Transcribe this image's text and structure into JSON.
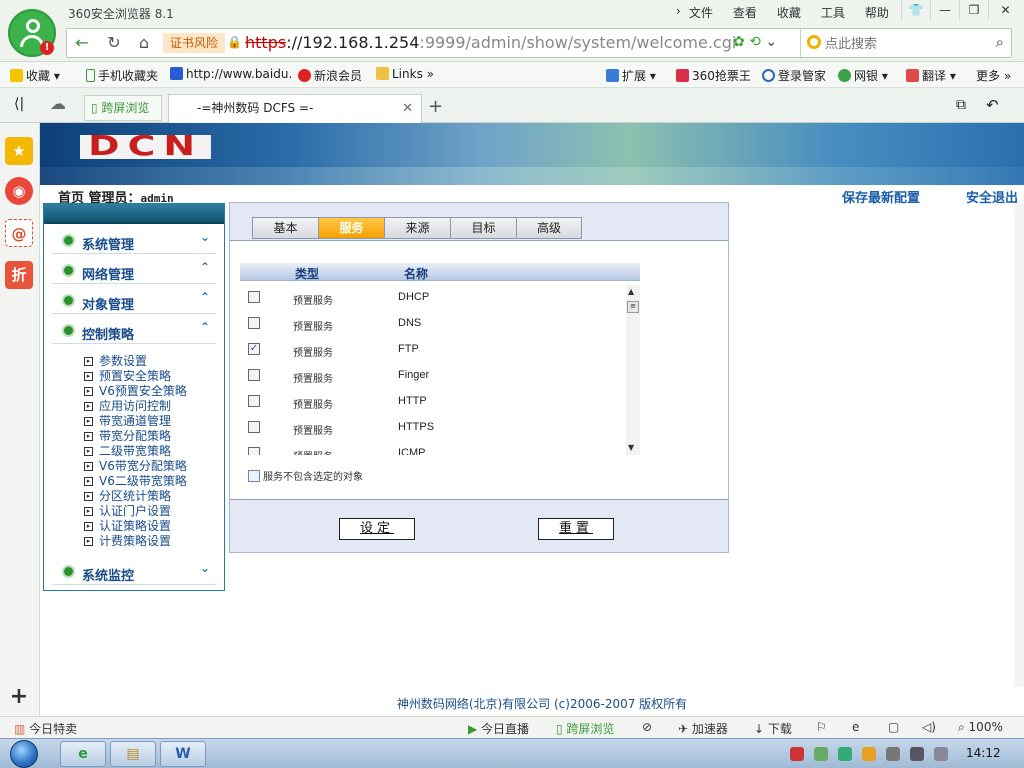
{
  "browser": {
    "title": "360安全浏览器 8.1",
    "menu": [
      "文件",
      "查看",
      "收藏",
      "工具",
      "帮助"
    ],
    "window_buttons": [
      "👕",
      "—",
      "❐",
      "✕"
    ],
    "cert_warning": "证书风险",
    "url_scheme": "https",
    "url_host": "://192.168.1.254",
    "url_rest": ":9999/admin/show/system/welcome.cgi",
    "search_placeholder": "点此搜索",
    "favorites": [
      "收藏",
      "手机收藏夹",
      "http://www.baidu.",
      "新浪会员",
      "Links",
      "扩展",
      "360抢票王",
      "登录管家",
      "网银",
      "翻译",
      "更多"
    ],
    "tab_split_label": "跨屏浏览",
    "tab_title": "-=神州数码 DCFS =-",
    "colors": {
      "accent": "#3bb34a",
      "cert": "#c25b00",
      "url_scheme": "#cc0000"
    }
  },
  "page": {
    "banner_logo": "DCN",
    "breadcrumb": "首页 管理员：",
    "admin_name": "admin",
    "save_config": "保存最新配置",
    "logout": "安全退出",
    "sidebar": {
      "sections": [
        {
          "label": "系统管理",
          "chev": "⌄"
        },
        {
          "label": "网络管理",
          "chev": "⌃"
        },
        {
          "label": "对象管理",
          "chev": "⌃"
        },
        {
          "label": "控制策略",
          "chev": "⌃"
        }
      ],
      "sub_items": [
        "参数设置",
        "预置安全策略",
        "V6预置安全策略",
        "应用访问控制",
        "带宽通道管理",
        "带宽分配策略",
        "二级带宽策略",
        "V6带宽分配策略",
        "V6二级带宽策略",
        "分区统计策略",
        "认证门户设置",
        "认证策略设置",
        "计费策略设置"
      ],
      "last_section": {
        "label": "系统监控",
        "chev": "⌄"
      }
    },
    "tabs": [
      "基本",
      "服务",
      "来源",
      "目标",
      "高级"
    ],
    "active_tab": "服务",
    "list_headers": {
      "type": "类型",
      "name": "名称"
    },
    "services": [
      {
        "type": "预置服务",
        "name": "DHCP",
        "checked": false
      },
      {
        "type": "预置服务",
        "name": "DNS",
        "checked": false
      },
      {
        "type": "预置服务",
        "name": "FTP",
        "checked": true
      },
      {
        "type": "预置服务",
        "name": "Finger",
        "checked": false
      },
      {
        "type": "预置服务",
        "name": "HTTP",
        "checked": false
      },
      {
        "type": "预置服务",
        "name": "HTTPS",
        "checked": false
      },
      {
        "type": "预置服务",
        "name": "ICMP",
        "checked": false
      }
    ],
    "exclude_label": "服务不包含选定的对象",
    "set_button": "设定",
    "reset_button": "重置",
    "footer": "神州数码网络(北京)有限公司  (c)2006-2007  版权所有"
  },
  "status": {
    "today_deal": "今日特卖",
    "live": "今日直播",
    "split": "跨屏浏览",
    "accelerator": "加速器",
    "download": "下载",
    "zoom": "100%"
  },
  "taskbar": {
    "clock": "14:12"
  }
}
